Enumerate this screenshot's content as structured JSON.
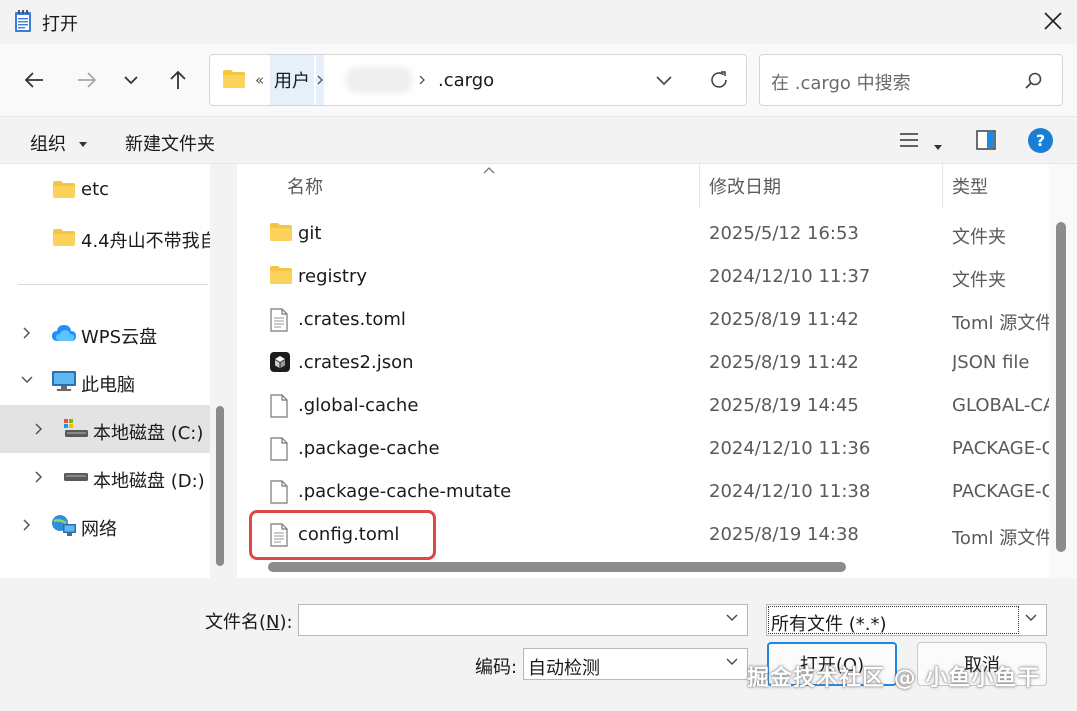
{
  "window": {
    "title": "打开"
  },
  "address": {
    "overflow": "«",
    "segments": [
      "用户",
      ".cargo"
    ]
  },
  "search": {
    "placeholder": "在 .cargo 中搜索"
  },
  "toolbar": {
    "organize": "组织",
    "new_folder": "新建文件夹",
    "help": "?"
  },
  "sidebar": {
    "items": [
      {
        "label": "etc"
      },
      {
        "label": "4.4舟山不带我自"
      },
      {
        "label": "WPS云盘"
      },
      {
        "label": "此电脑"
      },
      {
        "label": "本地磁盘 (C:)"
      },
      {
        "label": "本地磁盘 (D:)"
      },
      {
        "label": "网络"
      }
    ]
  },
  "columns": {
    "name": "名称",
    "date": "修改日期",
    "type": "类型"
  },
  "files": [
    {
      "name": "git",
      "date": "2025/5/12 16:53",
      "type": "文件夹",
      "icon": "folder-icon"
    },
    {
      "name": "registry",
      "date": "2024/12/10 11:37",
      "type": "文件夹",
      "icon": "folder-icon"
    },
    {
      "name": ".crates.toml",
      "date": "2025/8/19 11:42",
      "type": "Toml 源文件",
      "icon": "text-file-icon"
    },
    {
      "name": ".crates2.json",
      "date": "2025/8/19 11:42",
      "type": "JSON file",
      "icon": "json-file-icon"
    },
    {
      "name": ".global-cache",
      "date": "2025/8/19 14:45",
      "type": "GLOBAL-CACHE",
      "icon": "blank-file-icon"
    },
    {
      "name": ".package-cache",
      "date": "2024/12/10 11:36",
      "type": "PACKAGE-CACHE",
      "icon": "blank-file-icon"
    },
    {
      "name": ".package-cache-mutate",
      "date": "2024/12/10 11:38",
      "type": "PACKAGE-CACHE",
      "icon": "blank-file-icon"
    },
    {
      "name": "config.toml",
      "date": "2025/8/19 14:38",
      "type": "Toml 源文件",
      "icon": "text-file-icon"
    }
  ],
  "bottom": {
    "filename_label": "文件名(",
    "filename_key": "N",
    "filename_label_end": "):",
    "filename_value": "",
    "filetype_value": "所有文件  (*.*)",
    "encoding_label": "编码:",
    "encoding_value": "自动检测",
    "open_label": "打开(O)",
    "cancel_label": "取消"
  },
  "watermark": "掘金技术社区 @ 小鱼小鱼干",
  "colors": {
    "folder": "#f6c342",
    "highlight": "#e04646",
    "help": "#1a7fd4",
    "accent_blue": "#1e88e5"
  }
}
